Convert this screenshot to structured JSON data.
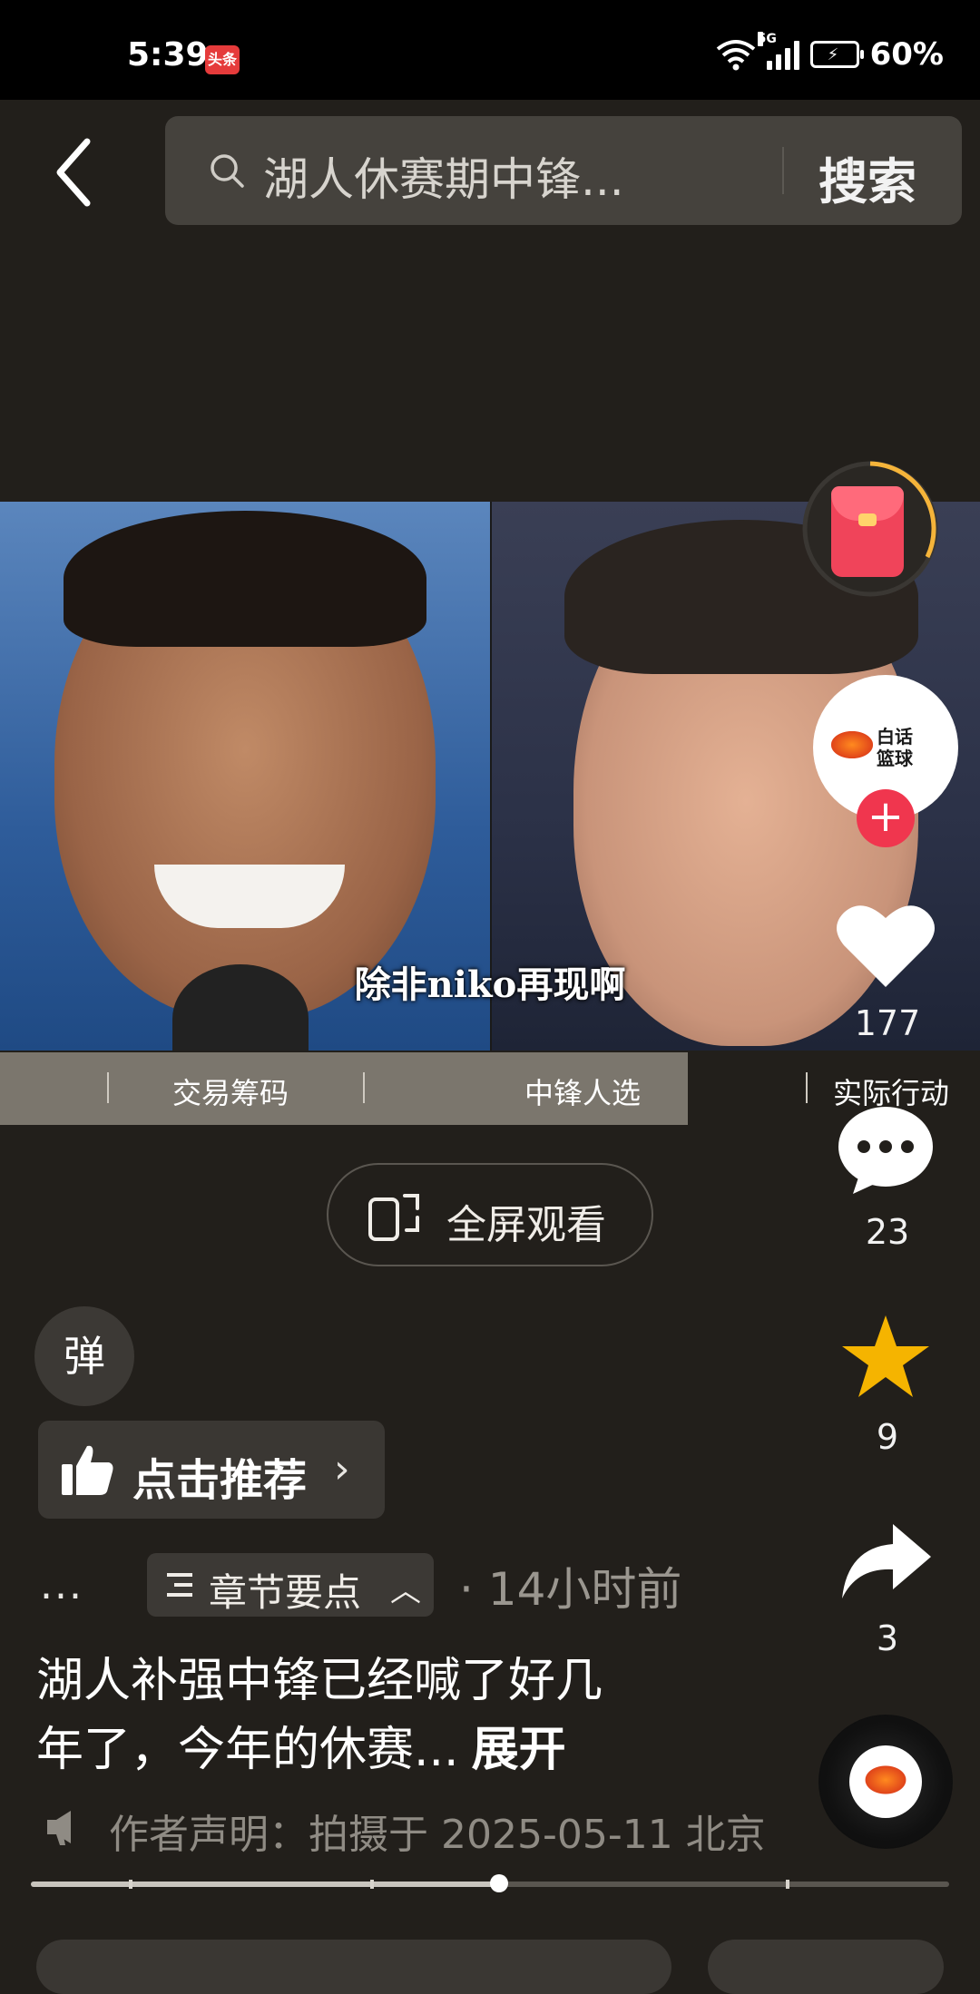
{
  "status_bar": {
    "time": "5:39",
    "app_badge": "头条",
    "network": "5G",
    "battery": "60%"
  },
  "search": {
    "query": "湖人休赛期中锋...",
    "button": "搜索"
  },
  "video": {
    "subtitle": "除非niko再现啊"
  },
  "chapters": {
    "items": [
      "交易筹码",
      "中锋人选",
      "实际行动"
    ]
  },
  "fullscreen": {
    "label": "全屏观看"
  },
  "danmu": {
    "label": "弹"
  },
  "recommend": {
    "label": "点击推荐"
  },
  "meta": {
    "more": "...",
    "chapter_points": "章节要点",
    "time_ago": "· 14小时前"
  },
  "caption": {
    "text_line1": "湖人补强中锋已经喊了好几",
    "text_line2": "年了，今年的休赛...",
    "expand": "展开"
  },
  "declaration": {
    "text": "作者声明：拍摄于 2025-05-11 北京"
  },
  "author": {
    "avatar_text_1": "白话",
    "avatar_text_2": "篮球",
    "follow_label": "+"
  },
  "actions": {
    "likes": "177",
    "comments": "23",
    "favorites": "9",
    "shares": "3"
  },
  "progress": {
    "played_fraction": 0.51
  },
  "colors": {
    "background": "#221f1b",
    "accent_red": "#f0364e",
    "star": "#f5b400"
  }
}
